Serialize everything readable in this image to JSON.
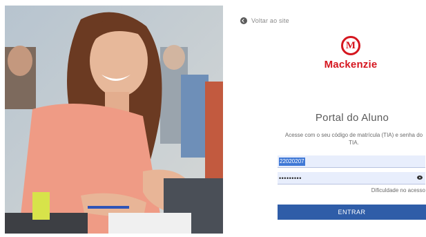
{
  "back_link": {
    "label": "Voltar ao site",
    "icon": "back-arrow-icon"
  },
  "brand": {
    "mark": "M",
    "name": "Mackenzie",
    "color": "#d5161f"
  },
  "portal": {
    "title": "Portal do Aluno",
    "instructions": "Acesse com o seu código de matrícula (TIA) e senha do TIA."
  },
  "form": {
    "tia_value": "22020207",
    "password_value": "•••••••••",
    "password_icon": "eye-icon",
    "forgot_label": "Dificuldade no acesso",
    "submit_label": "ENTRAR",
    "submit_color": "#2f5da8"
  },
  "photo": {
    "alt_icon": "student-photo"
  }
}
